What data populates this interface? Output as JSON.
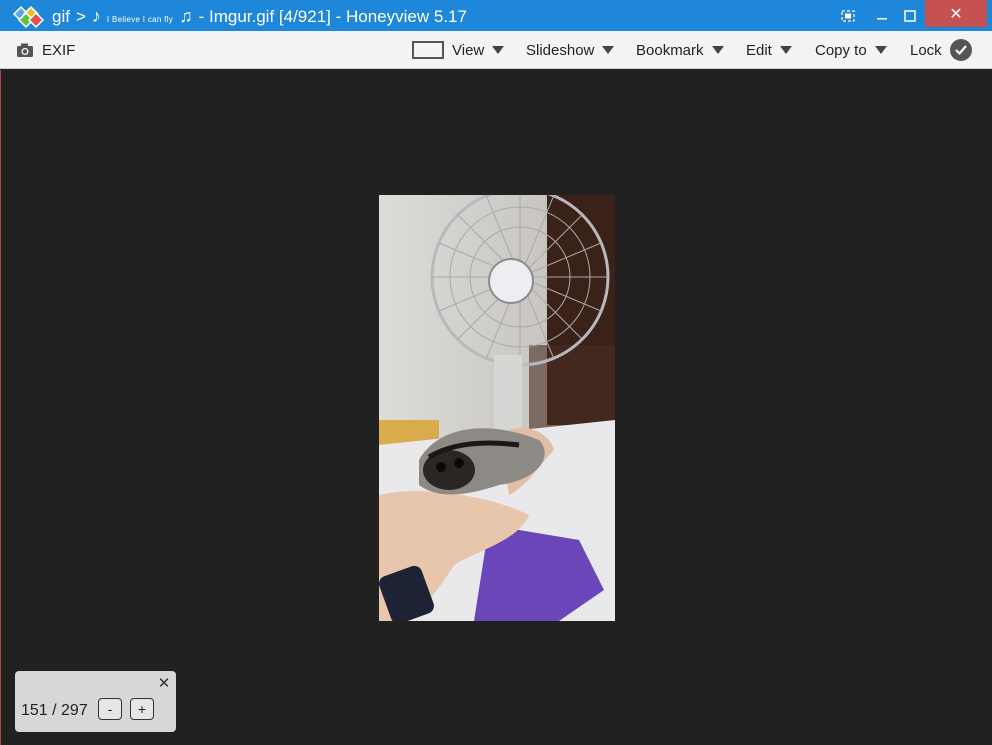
{
  "titlebar": {
    "folder": "gif",
    "separator": ">",
    "note_left": "♪",
    "song_words": "I Believe I can fly",
    "note_right": "♫",
    "file": "- Imgur.gif [4/921] - Honeyview 5.17",
    "close_glyph": "✕"
  },
  "toolbar": {
    "exif": "EXIF",
    "view": "View",
    "slideshow": "Slideshow",
    "bookmark": "Bookmark",
    "edit": "Edit",
    "copy_to": "Copy to",
    "lock": "Lock"
  },
  "frame_panel": {
    "counter": "151 / 297",
    "minus": "-",
    "plus": "+",
    "close_glyph": "✕"
  },
  "colors": {
    "titlebar": "#1e87d9",
    "close_button": "#c75050",
    "toolbar": "#f3f3f3",
    "viewer_bg": "#212121",
    "panel_bg": "#d7d7d7"
  },
  "icons": [
    "app-logo-icon",
    "fullscreen-icon",
    "minimize-icon",
    "maximize-icon",
    "close-icon",
    "camera-icon",
    "fit-screen-icon",
    "chevron-down-icon",
    "check-icon"
  ]
}
